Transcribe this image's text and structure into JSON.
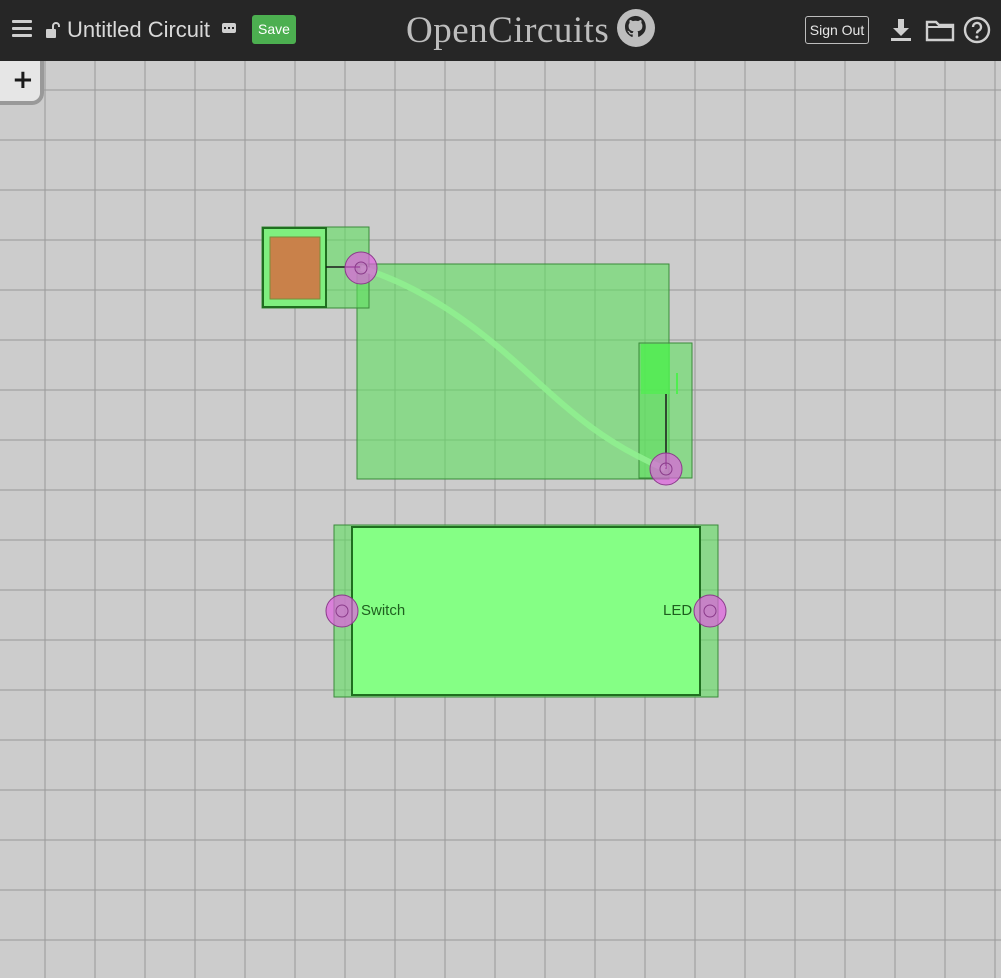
{
  "header": {
    "circuit_name": "Untitled Circuit",
    "save_label": "Save",
    "logo_text": "OpenCircuits",
    "signout_label": "Sign Out"
  },
  "toolbar": {
    "add_label": "+"
  },
  "canvas": {
    "ic_inputs": [
      {
        "label": "Switch"
      }
    ],
    "ic_outputs": [
      {
        "label": "LED"
      }
    ]
  },
  "colors": {
    "header_bg": "#262626",
    "canvas_bg": "#cccccc",
    "grid_line": "#999999",
    "selection_green": "#6fe06f",
    "switch_body": "#c9814a",
    "port_magenta": "#e05fe0",
    "save_green": "#4caf50"
  },
  "icons": [
    "menu-icon",
    "lock-icon",
    "dots-icon",
    "github-icon",
    "download-icon",
    "folder-icon",
    "help-icon",
    "plus-icon"
  ]
}
